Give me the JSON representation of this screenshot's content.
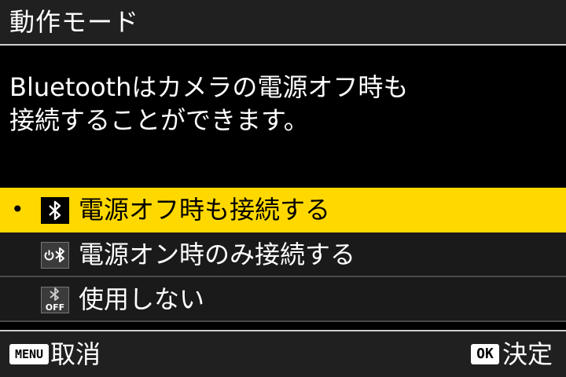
{
  "header": {
    "title": "動作モード"
  },
  "description": {
    "line1": "Bluetoothはカメラの電源オフ時も",
    "line2": "接続することができます。"
  },
  "options": [
    {
      "label": "電源オフ時も接続する",
      "icon": "bluetooth-icon",
      "selected": true,
      "bullet": "•"
    },
    {
      "label": "電源オン時のみ接続する",
      "icon": "power-bluetooth-icon",
      "selected": false
    },
    {
      "label": "使用しない",
      "icon": "bluetooth-off-icon",
      "selected": false,
      "icon_text": "OFF"
    }
  ],
  "footer": {
    "menu_key": "MENU",
    "cancel_label": "取消",
    "ok_key": "OK",
    "confirm_label": "決定"
  },
  "colors": {
    "selected_background": "#ffd800",
    "background": "#000000",
    "bar_background": "#202020",
    "item_background": "#1a1a1a"
  }
}
